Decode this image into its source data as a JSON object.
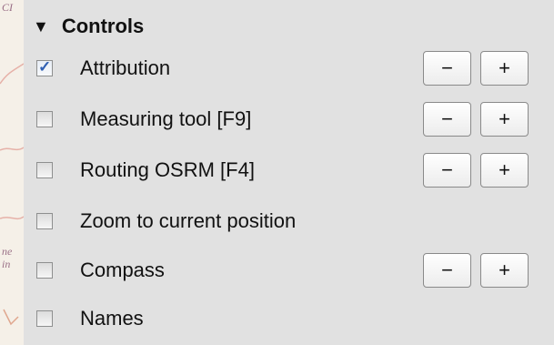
{
  "header": {
    "arrow": "▼",
    "title": "Controls"
  },
  "map_strip": {
    "texts": [
      "CI",
      "ne",
      "in"
    ]
  },
  "controls": [
    {
      "label": "Attribution",
      "checked": true,
      "has_zoom_buttons": true
    },
    {
      "label": "Measuring tool [F9]",
      "checked": false,
      "has_zoom_buttons": true
    },
    {
      "label": "Routing OSRM [F4]",
      "checked": false,
      "has_zoom_buttons": true
    },
    {
      "label": "Zoom to current position",
      "checked": false,
      "has_zoom_buttons": false
    },
    {
      "label": "Compass",
      "checked": false,
      "has_zoom_buttons": true
    },
    {
      "label": "Names",
      "checked": false,
      "has_zoom_buttons": false
    }
  ],
  "buttons": {
    "minus_label": "−",
    "plus_label": "+"
  },
  "checkbox": {
    "checked_glyph": "✓"
  }
}
